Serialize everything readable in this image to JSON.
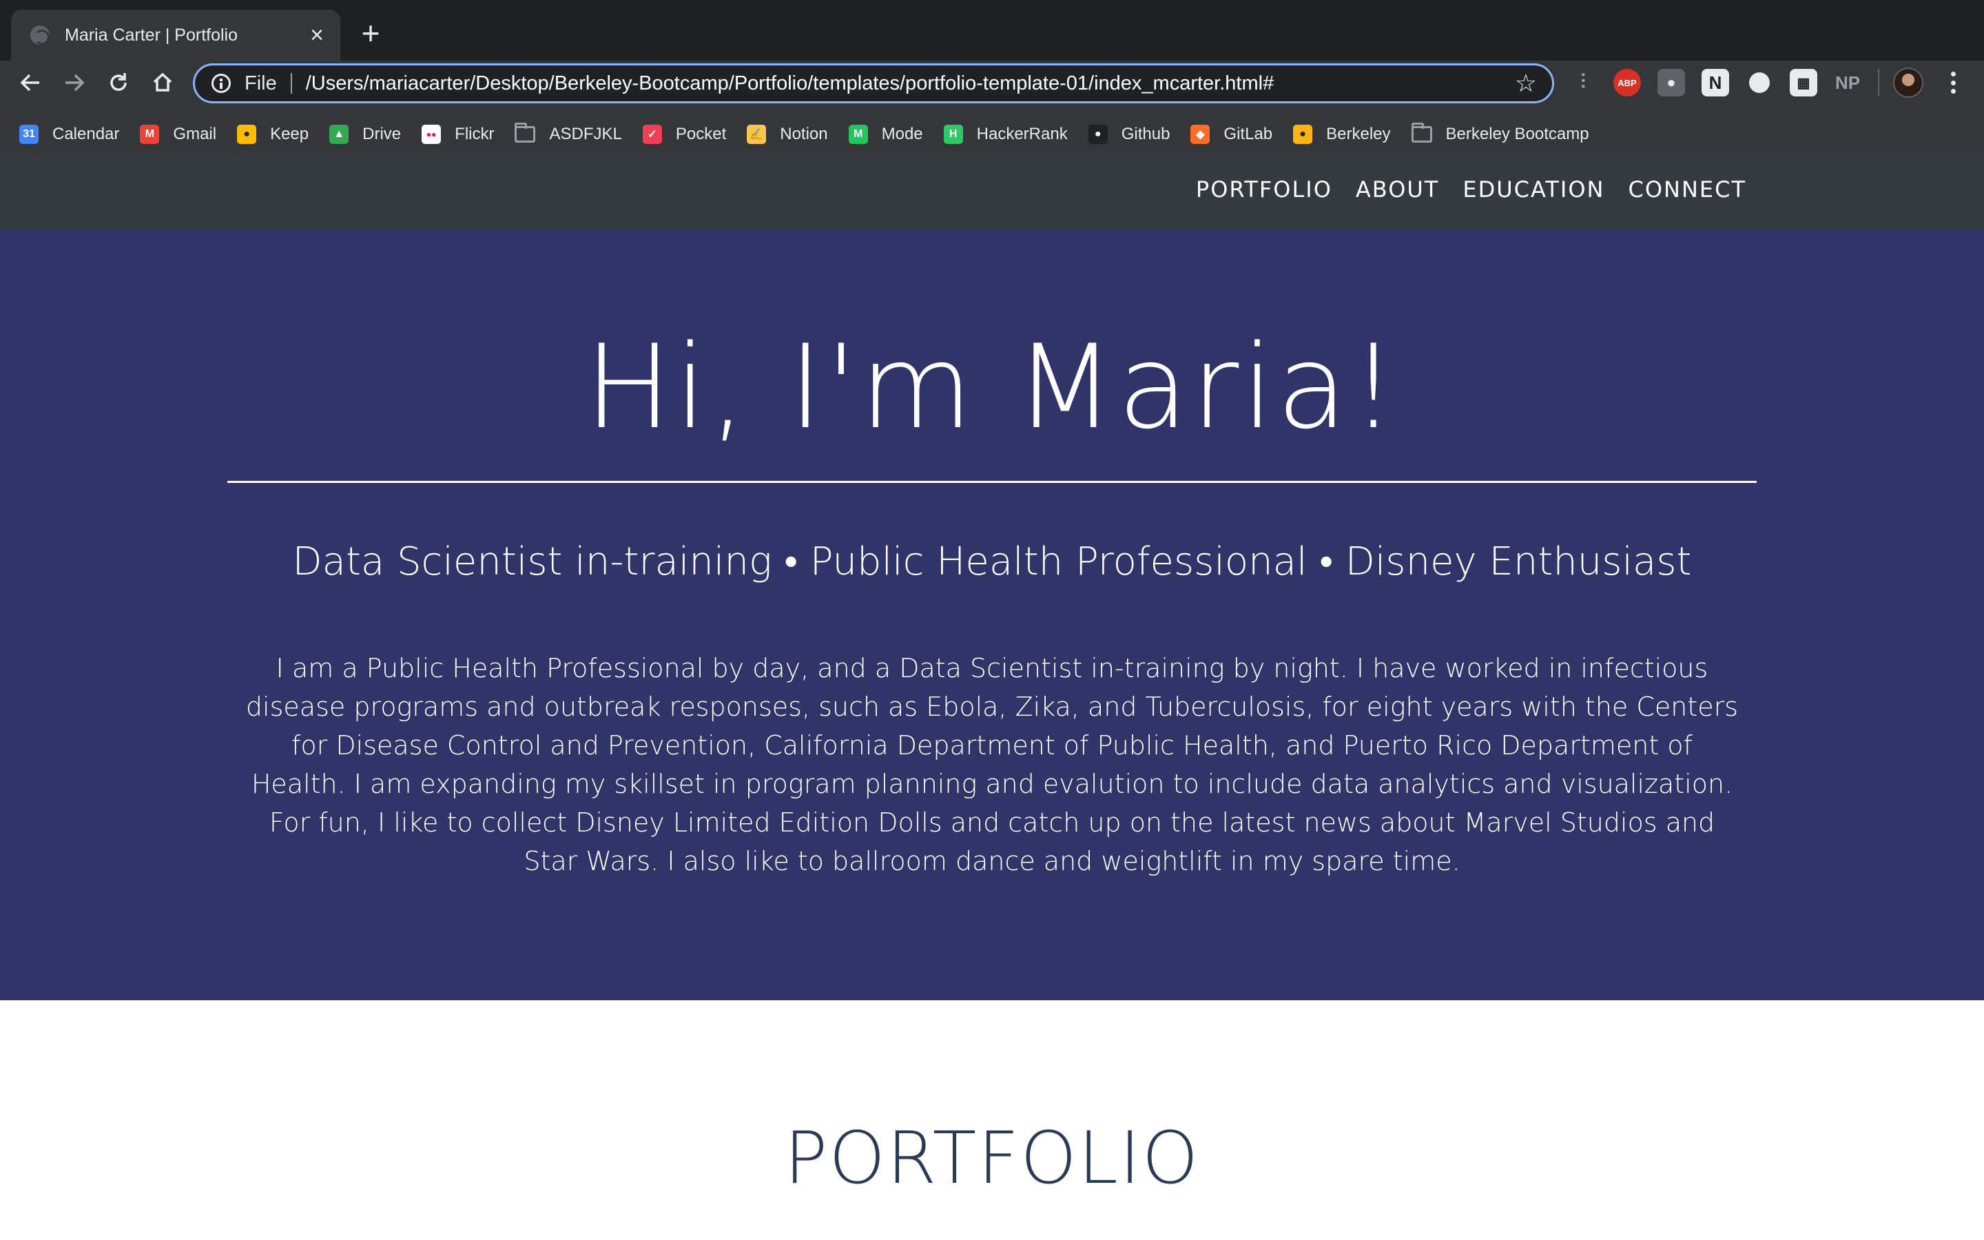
{
  "browser": {
    "tab_title": "Maria Carter | Portfolio",
    "url_scheme": "File",
    "url": "/Users/mariacarter/Desktop/Berkeley-Bootcamp/Portfolio/templates/portfolio-template-01/index_mcarter.html#",
    "extension_labels": [
      "ABP",
      "NP"
    ]
  },
  "bookmarks": [
    {
      "label": "Calendar",
      "icon": "calendar-icon",
      "color": "#4285f4",
      "glyph": "31"
    },
    {
      "label": "Gmail",
      "icon": "gmail-icon",
      "color": "#ea4335",
      "glyph": "M"
    },
    {
      "label": "Keep",
      "icon": "keep-icon",
      "color": "#fbbc04",
      "glyph": "●"
    },
    {
      "label": "Drive",
      "icon": "drive-icon",
      "color": "#34a853",
      "glyph": "▲"
    },
    {
      "label": "Flickr",
      "icon": "flickr-icon",
      "color": "#ffffff",
      "glyph": "●●"
    },
    {
      "label": "ASDFJKL",
      "icon": "folder-icon",
      "color": "",
      "glyph": ""
    },
    {
      "label": "Pocket",
      "icon": "pocket-icon",
      "color": "#ef4056",
      "glyph": "✓"
    },
    {
      "label": "Notion",
      "icon": "notion-icon",
      "color": "#f9c74f",
      "glyph": "✍"
    },
    {
      "label": "Mode",
      "icon": "mode-icon",
      "color": "#22c55e",
      "glyph": "M"
    },
    {
      "label": "HackerRank",
      "icon": "hackerrank-icon",
      "color": "#2ec866",
      "glyph": "H"
    },
    {
      "label": "Github",
      "icon": "github-icon",
      "color": "#202124",
      "glyph": "●"
    },
    {
      "label": "GitLab",
      "icon": "gitlab-icon",
      "color": "#fc6d26",
      "glyph": "◆"
    },
    {
      "label": "Berkeley",
      "icon": "berkeley-icon",
      "color": "#fdb515",
      "glyph": "●"
    },
    {
      "label": "Berkeley Bootcamp",
      "icon": "folder-icon",
      "color": "",
      "glyph": ""
    }
  ],
  "nav": {
    "links": [
      "PORTFOLIO",
      "ABOUT",
      "EDUCATION",
      "CONNECT"
    ]
  },
  "hero": {
    "title": "Hi, I'm Maria!",
    "subtitle": "Data Scientist in-training • Public Health Professional • Disney Enthusiast",
    "bio": "I am a Public Health Professional by day, and a Data Scientist in-training by night. I have worked in infectious disease programs and outbreak responses, such as Ebola, Zika, and Tuberculosis, for eight years with the Centers for Disease Control and Prevention, California Department of Public Health, and Puerto Rico Department of Health. I am expanding my skillset in program planning and evalution to include data analytics and visualization. For fun, I like to collect Disney Limited Edition Dolls and catch up on the latest news about Marvel Studios and Star Wars. I also like to ballroom dance and weightlift in my spare time."
  },
  "portfolio": {
    "heading": "PORTFOLIO"
  },
  "colors": {
    "hero_bg": "#303468",
    "nav_bg": "#343a40",
    "heading_text": "#2b3a55"
  }
}
